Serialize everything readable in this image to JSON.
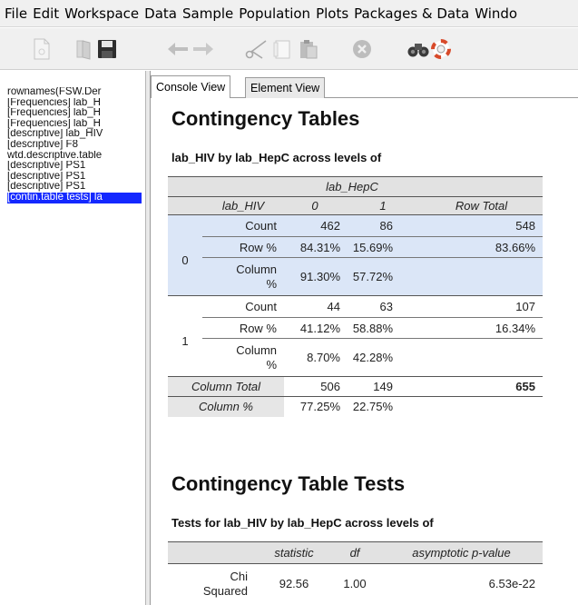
{
  "menu": [
    "File",
    "Edit",
    "Workspace",
    "Data",
    "Sample",
    "Population",
    "Plots",
    "Packages & Data",
    "Windo"
  ],
  "toolbar_icons": [
    "new-document-icon",
    "open-folder-icon",
    "save-disk-icon",
    "undo-arrow-icon",
    "redo-arrow-icon",
    "cut-scissors-icon",
    "copy-icon",
    "paste-icon",
    "stop-icon",
    "find-binoculars-icon",
    "help-lifebuoy-icon"
  ],
  "outline": {
    "items": [
      "rownames(FSW.Der",
      "[Frequencies] lab_H",
      "[Frequencies] lab_H",
      "[Frequencies] lab_H",
      "[descriptive] lab_HIV",
      "[descriptive] F8",
      "wtd.descriptive.table",
      "[descriptive] PS1",
      "[descriptive] PS1",
      "[descriptive] PS1",
      "[contin.table tests] la"
    ],
    "selected_index": 10
  },
  "tabs": {
    "console": "Console View",
    "element": "Element View"
  },
  "colors": {
    "selection": "#1428ff",
    "row_highlight": "#dbe6f7",
    "header_gray": "#e2e2e2",
    "total_gray": "#e6e6e6"
  },
  "contingency": {
    "title": "Contingency Tables",
    "subtitle": "lab_HIV by lab_HepC across levels of",
    "col_var": "lab_HepC",
    "row_var": "lab_HIV",
    "col_levels": [
      "0",
      "1"
    ],
    "row_total_label": "Row Total",
    "groups": [
      {
        "level": "0",
        "count_label": "Count",
        "count": [
          "462",
          "86",
          "548"
        ],
        "rowpct_label": "Row %",
        "rowpct": [
          "84.31%",
          "15.69%",
          "83.66%"
        ],
        "colpct_label_1": "Column",
        "colpct_label_2": "%",
        "colpct": [
          "91.30%",
          "57.72%"
        ]
      },
      {
        "level": "1",
        "count_label": "Count",
        "count": [
          "44",
          "63",
          "107"
        ],
        "rowpct_label": "Row %",
        "rowpct": [
          "41.12%",
          "58.88%",
          "16.34%"
        ],
        "colpct_label_1": "Column",
        "colpct_label_2": "%",
        "colpct": [
          "8.70%",
          "42.28%"
        ]
      }
    ],
    "column_total_label": "Column Total",
    "column_total": [
      "506",
      "149",
      "655"
    ],
    "column_pct_label": "Column %",
    "column_pct": [
      "77.25%",
      "22.75%"
    ]
  },
  "tests": {
    "title": "Contingency Table Tests",
    "subtitle": "Tests for lab_HIV by lab_HepC across levels of",
    "headers": [
      "statistic",
      "df",
      "asymptotic p-value"
    ],
    "rows": [
      {
        "name_1": "Chi",
        "name_2": "Squared",
        "statistic": "92.56",
        "df": "1.00",
        "p": "6.53e-22"
      }
    ]
  }
}
